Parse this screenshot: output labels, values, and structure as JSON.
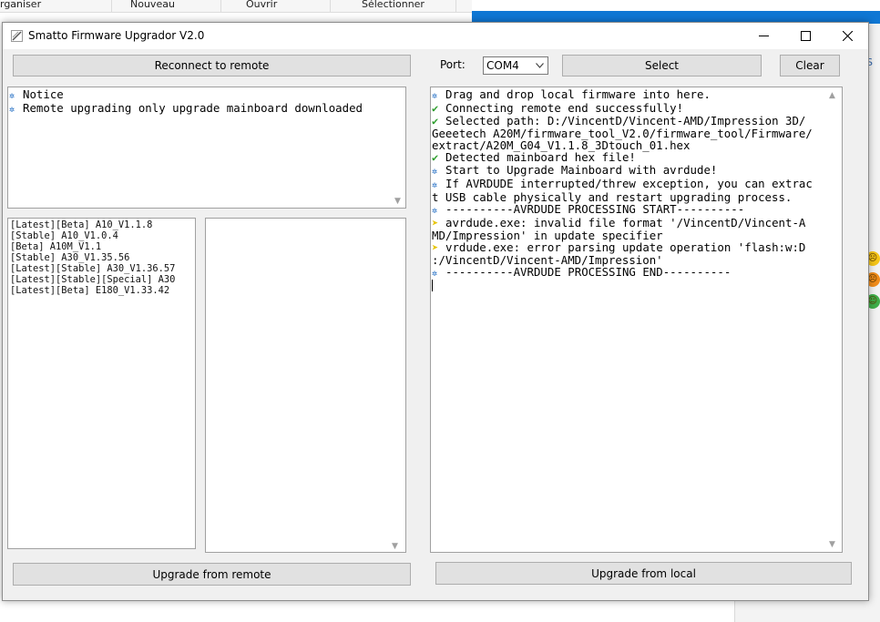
{
  "background": {
    "explorer_tabs": [
      "rganiser",
      "Nouveau",
      "Ouvrir",
      "Sélectionner"
    ],
    "side_label": "S"
  },
  "window": {
    "title": "Smatto Firmware Upgrador V2.0"
  },
  "toolbar": {
    "reconnect_label": "Reconnect to remote",
    "port_label": "Port:",
    "port_value": "COM4",
    "select_label": "Select",
    "clear_label": "Clear"
  },
  "notice": {
    "lines": [
      {
        "icon": "gear",
        "text": "Notice"
      },
      {
        "icon": "gear",
        "text": "Remote upgrading only upgrade mainboard downloaded"
      }
    ]
  },
  "firmware_list": [
    "[Latest][Beta] A10_V1.1.8",
    "[Stable] A10_V1.0.4",
    "[Beta] A10M_V1.1",
    "[Stable] A30_V1.35.56",
    "[Latest][Stable] A30_V1.36.57",
    "[Latest][Stable][Special] A30",
    "[Latest][Beta] E180_V1.33.42"
  ],
  "log": {
    "lines": [
      {
        "icon": "gear",
        "text": "Drag and drop local firmware into here."
      },
      {
        "icon": "check",
        "text": "Connecting remote end successfully!"
      },
      {
        "icon": "check",
        "text": "Selected path: D:/VincentD/Vincent-AMD/Impression 3D/"
      },
      {
        "icon": "",
        "text": "Geeetech A20M/firmware_tool_V2.0/firmware_tool/Firmware/"
      },
      {
        "icon": "",
        "text": "extract/A20M_G04_V1.1.8_3Dtouch_01.hex"
      },
      {
        "icon": "check",
        "text": "Detected mainboard hex file!"
      },
      {
        "icon": "gear",
        "text": "Start to Upgrade Mainboard with avrdude!"
      },
      {
        "icon": "gear",
        "text": "If AVRDUDE interrupted/threw exception, you can extrac"
      },
      {
        "icon": "",
        "text": "t USB cable physically and restart upgrading process."
      },
      {
        "icon": "gear",
        "text": "----------AVRDUDE PROCESSING START----------"
      },
      {
        "icon": "arrow",
        "text": "avrdude.exe: invalid file format '/VincentD/Vincent-A"
      },
      {
        "icon": "",
        "text": "MD/Impression' in update specifier"
      },
      {
        "icon": "arrow",
        "text": "vrdude.exe: error parsing update operation 'flash:w:D"
      },
      {
        "icon": "",
        "text": ":/VincentD/Vincent-AMD/Impression'"
      },
      {
        "icon": "gear",
        "text": "----------AVRDUDE PROCESSING END----------"
      }
    ]
  },
  "footer": {
    "upgrade_remote_label": "Upgrade from remote",
    "upgrade_local_label": "Upgrade from local"
  },
  "colors": {
    "accent_blue": "#0f77d4",
    "gear": "#1565c0",
    "check": "#2e9e2e",
    "arrow": "#e6c400"
  }
}
